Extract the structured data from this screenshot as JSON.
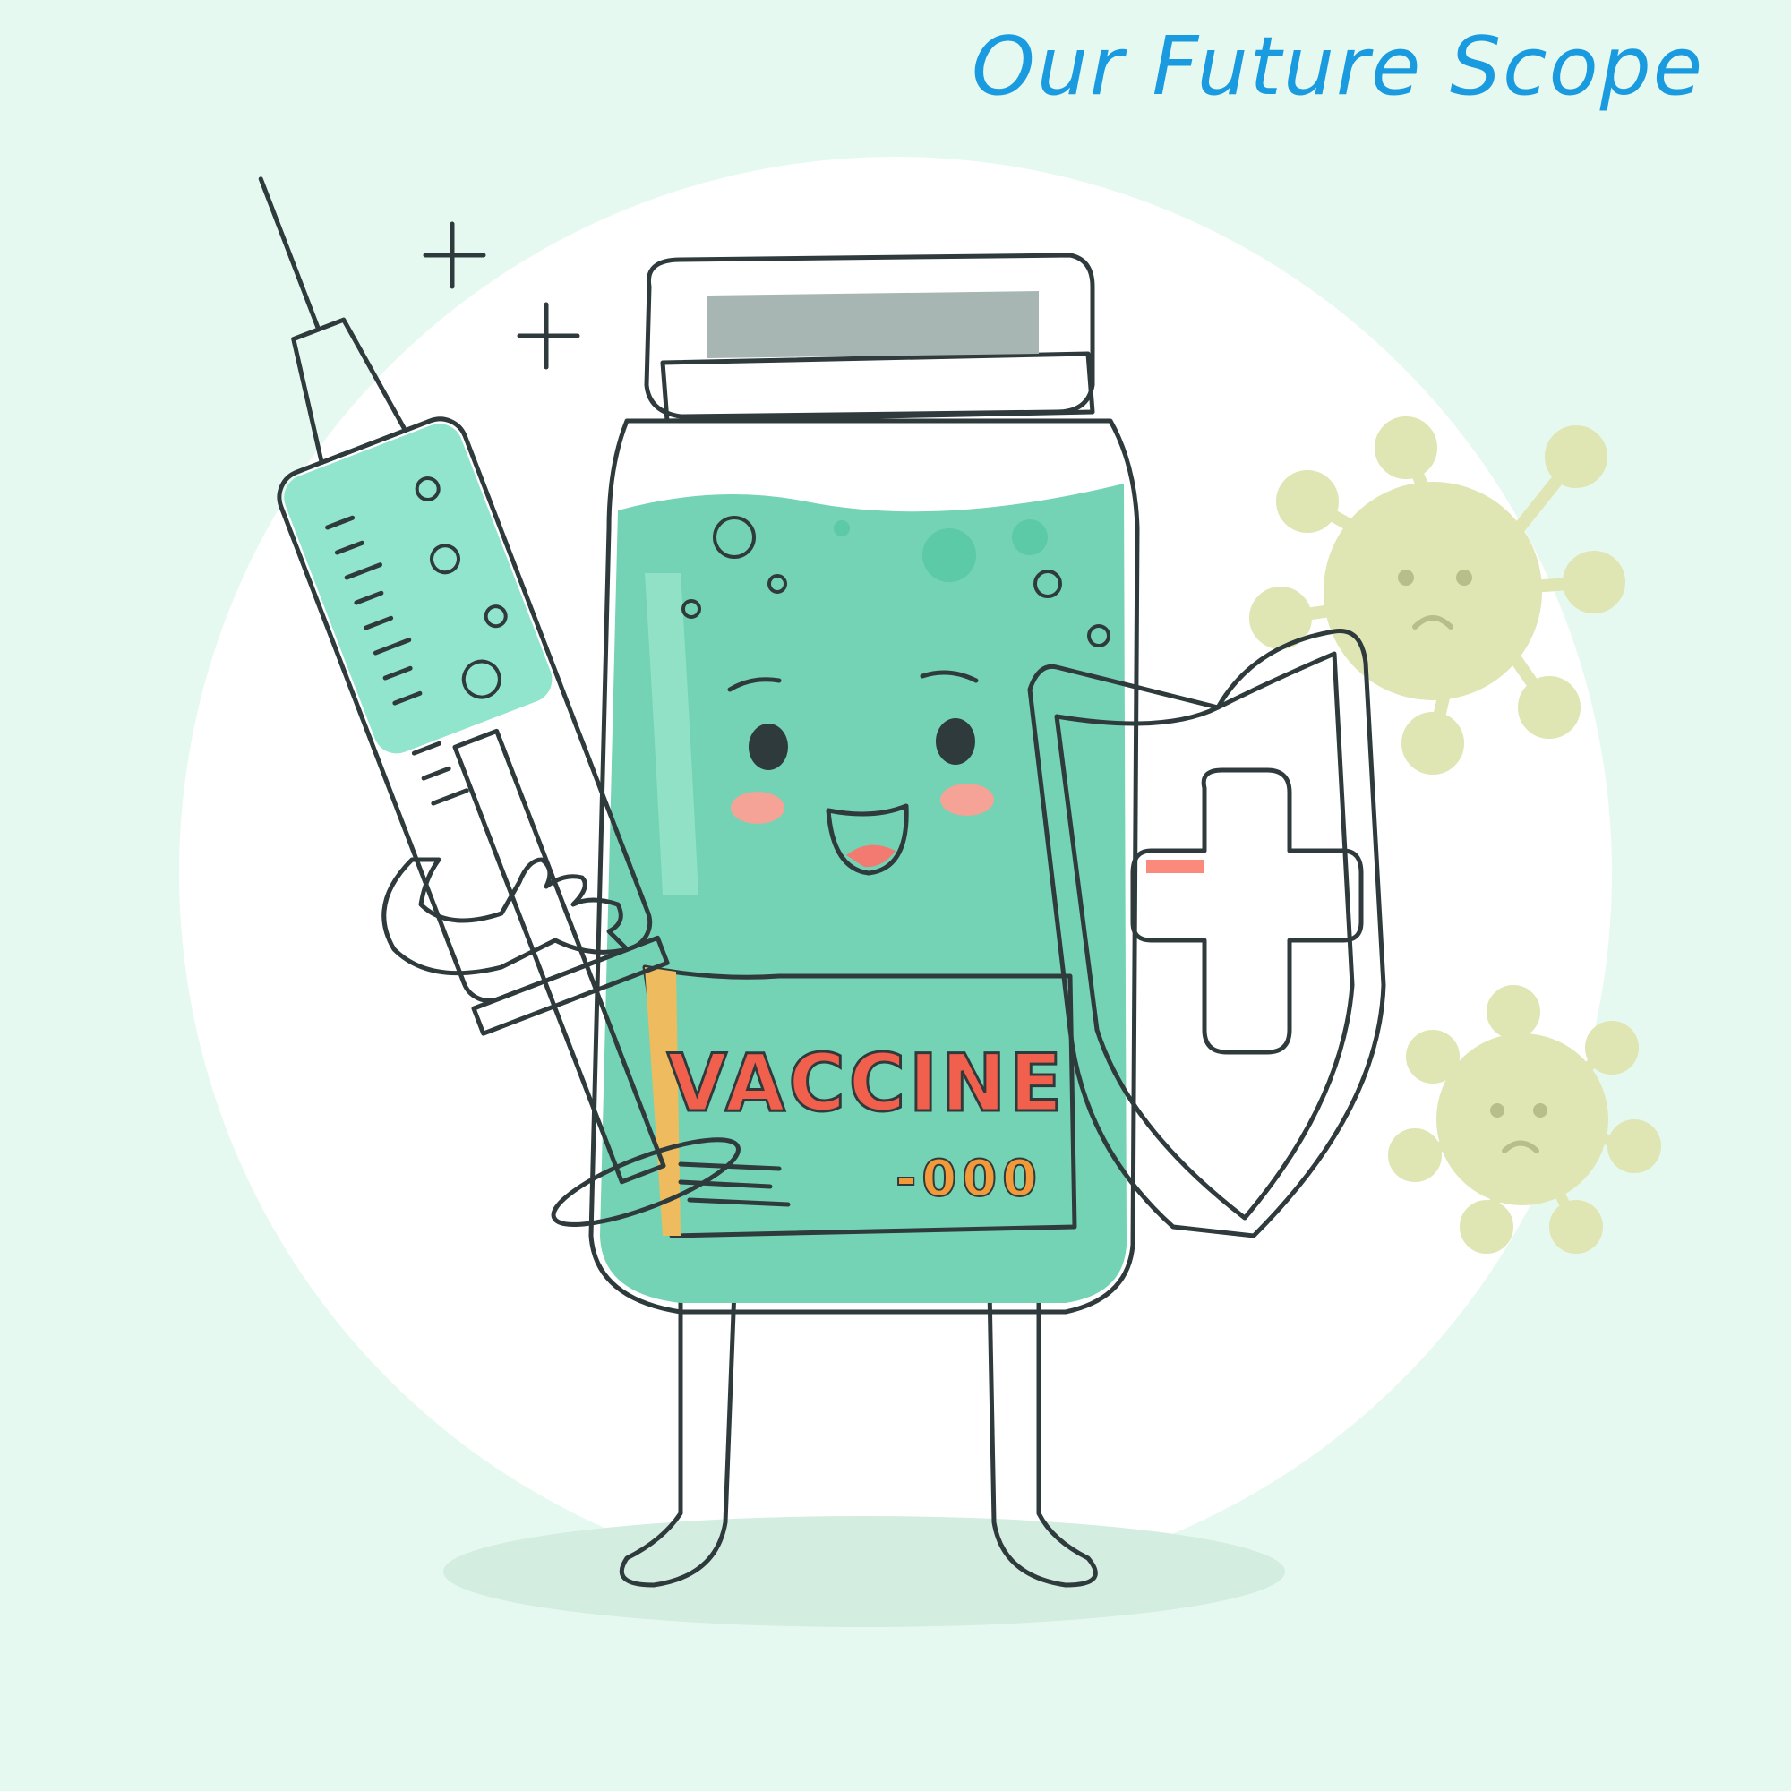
{
  "title": "Our Future Scope",
  "vial": {
    "label": "VACCINE",
    "code": "-000"
  },
  "icons": {
    "vial": "vaccine-vial-character-icon",
    "syringe": "syringe-icon",
    "shield": "medical-cross-shield-icon",
    "virus": "virus-icon",
    "sparkle": "sparkle-icon"
  },
  "colors": {
    "background": "#e6f9f0",
    "title": "#1a9be0",
    "vial_liquid": "#73d3b4",
    "cap": "#8e9c9a",
    "label_band": "#f9d895",
    "label_text": "#f0604c",
    "shield": "#f5a070",
    "cross": "#f45c4c",
    "virus": "#dfe6b3"
  }
}
